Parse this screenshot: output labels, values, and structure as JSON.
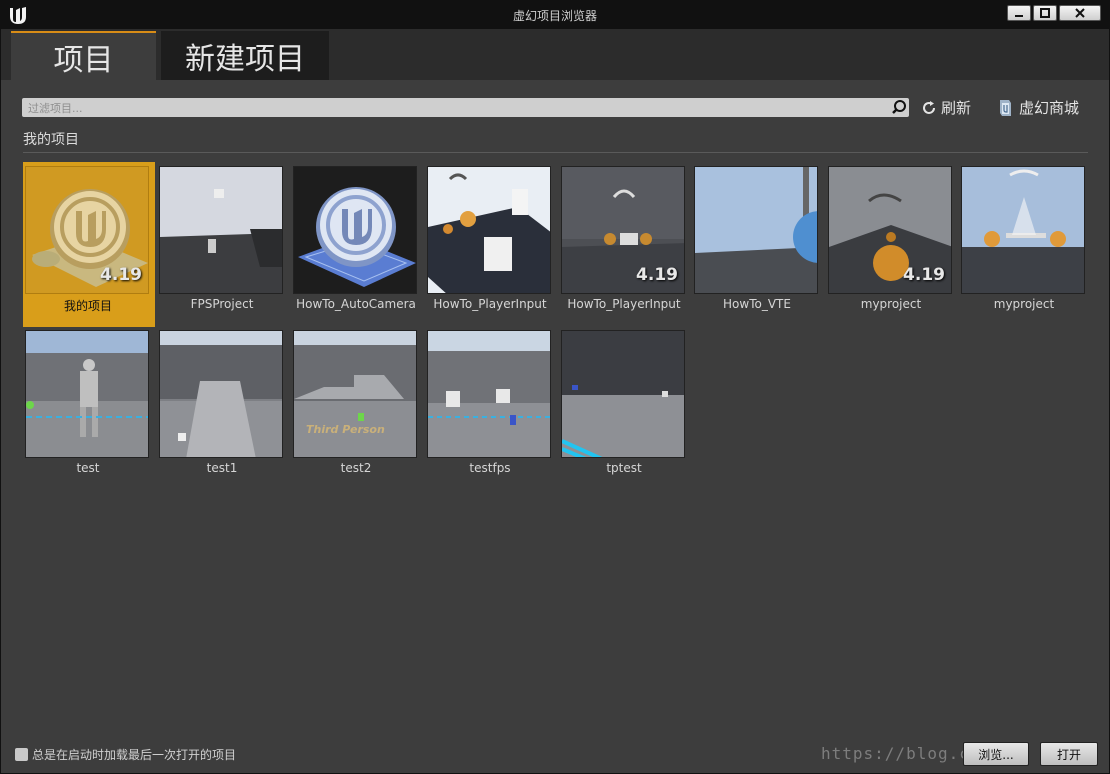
{
  "window": {
    "title": "虚幻项目浏览器"
  },
  "tabs": [
    {
      "label": "项目"
    },
    {
      "label": "新建项目"
    }
  ],
  "search": {
    "placeholder": "过滤项目..."
  },
  "toolbar": {
    "refresh_label": "刷新",
    "market_label": "虚幻商城"
  },
  "section": {
    "title": "我的项目"
  },
  "projects": [
    {
      "name": "我的项目",
      "version": "4.19",
      "icon": "unreal-coin-icon"
    },
    {
      "name": "FPSProject",
      "version": ""
    },
    {
      "name": "HowTo_AutoCamera",
      "version": "",
      "icon": "unreal-coin-icon"
    },
    {
      "name": "HowTo_PlayerInput",
      "version": ""
    },
    {
      "name": "HowTo_PlayerInput",
      "version": "4.19"
    },
    {
      "name": "HowTo_VTE",
      "version": ""
    },
    {
      "name": "myproject",
      "version": "4.19"
    },
    {
      "name": "myproject",
      "version": ""
    },
    {
      "name": "test",
      "version": ""
    },
    {
      "name": "test1",
      "version": ""
    },
    {
      "name": "test2",
      "version": "",
      "overlay_text": "Third Person"
    },
    {
      "name": "testfps",
      "version": ""
    },
    {
      "name": "tptest",
      "version": ""
    }
  ],
  "footer": {
    "autoload_label": "总是在启动时加载最后一次打开的项目",
    "watermark": "https://blog.c",
    "browse_label": "浏览...",
    "open_label": "打开"
  },
  "colors": {
    "accent": "#d99e1a",
    "background": "#3d3d3d",
    "tab_accent": "#d88c16"
  }
}
